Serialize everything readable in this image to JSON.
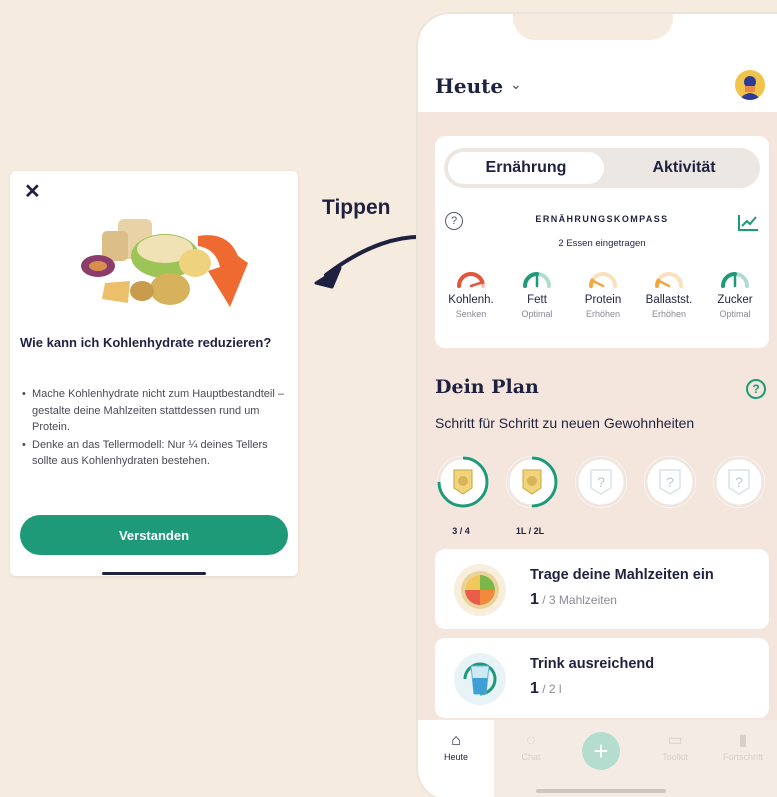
{
  "annotation": {
    "label": "Tippen"
  },
  "popup": {
    "close_icon": "close-icon",
    "title": "Wie kann ich Kohlenhydrate reduzieren?",
    "bullets": [
      "Mache Kohlenhydrate nicht zum Hauptbestandteil – gestalte deine Mahlzeiten stattdessen rund um Protein.",
      "Denke an das Tellermodell: Nur ¼ deines Tellers sollte aus Kohlenhydraten bestehen."
    ],
    "button_label": "Verstanden"
  },
  "header": {
    "title": "Heute",
    "chevron": "⌄"
  },
  "compass": {
    "tabs": [
      "Ernährung",
      "Aktivität"
    ],
    "active_tab": 0,
    "title": "ERNÄHRUNGSKOMPASS",
    "subtitle": "2 Essen eingetragen",
    "help": "?",
    "gauges": [
      {
        "label": "Kohlenh.",
        "status": "Senken",
        "level": 0.9,
        "color": "#e4563b"
      },
      {
        "label": "Fett",
        "status": "Optimal",
        "level": 0.5,
        "color": "#1e9a78"
      },
      {
        "label": "Protein",
        "status": "Erhöhen",
        "level": 0.15,
        "color": "#f2a640"
      },
      {
        "label": "Ballastst.",
        "status": "Erhöhen",
        "level": 0.15,
        "color": "#f2a640"
      },
      {
        "label": "Zucker",
        "status": "Optimal",
        "level": 0.5,
        "color": "#1e9a78"
      }
    ]
  },
  "plan": {
    "title": "Dein Plan",
    "help": "?",
    "subtitle": "Schritt für Schritt zu neuen Gewohnheiten",
    "badges": [
      {
        "label": "3 / 4",
        "progress": 0.75,
        "locked": false
      },
      {
        "label": "1L / 2L",
        "progress": 0.5,
        "locked": false
      },
      {
        "label": "",
        "progress": 0,
        "locked": true
      },
      {
        "label": "",
        "progress": 0,
        "locked": true
      },
      {
        "label": "",
        "progress": 0,
        "locked": true
      }
    ],
    "cards": [
      {
        "title": "Trage deine Mahlzeiten ein",
        "value": "1",
        "total": " / 3 Mahlzeiten",
        "icon": "plate-icon"
      },
      {
        "title": "Trink ausreichend",
        "value": "1",
        "total": " / 2 l",
        "icon": "water-glass-icon"
      }
    ]
  },
  "tabbar": {
    "items": [
      {
        "label": "Heute",
        "icon": "home-icon"
      },
      {
        "label": "Chat",
        "icon": "chat-icon"
      },
      {
        "label": "",
        "icon": "plus-icon"
      },
      {
        "label": "Toolkit",
        "icon": "book-icon"
      },
      {
        "label": "Fortschritt",
        "icon": "bar-chart-icon"
      }
    ]
  },
  "colors": {
    "accent": "#1e9a78",
    "background": "#f6ebdf",
    "text": "#1f2140"
  }
}
